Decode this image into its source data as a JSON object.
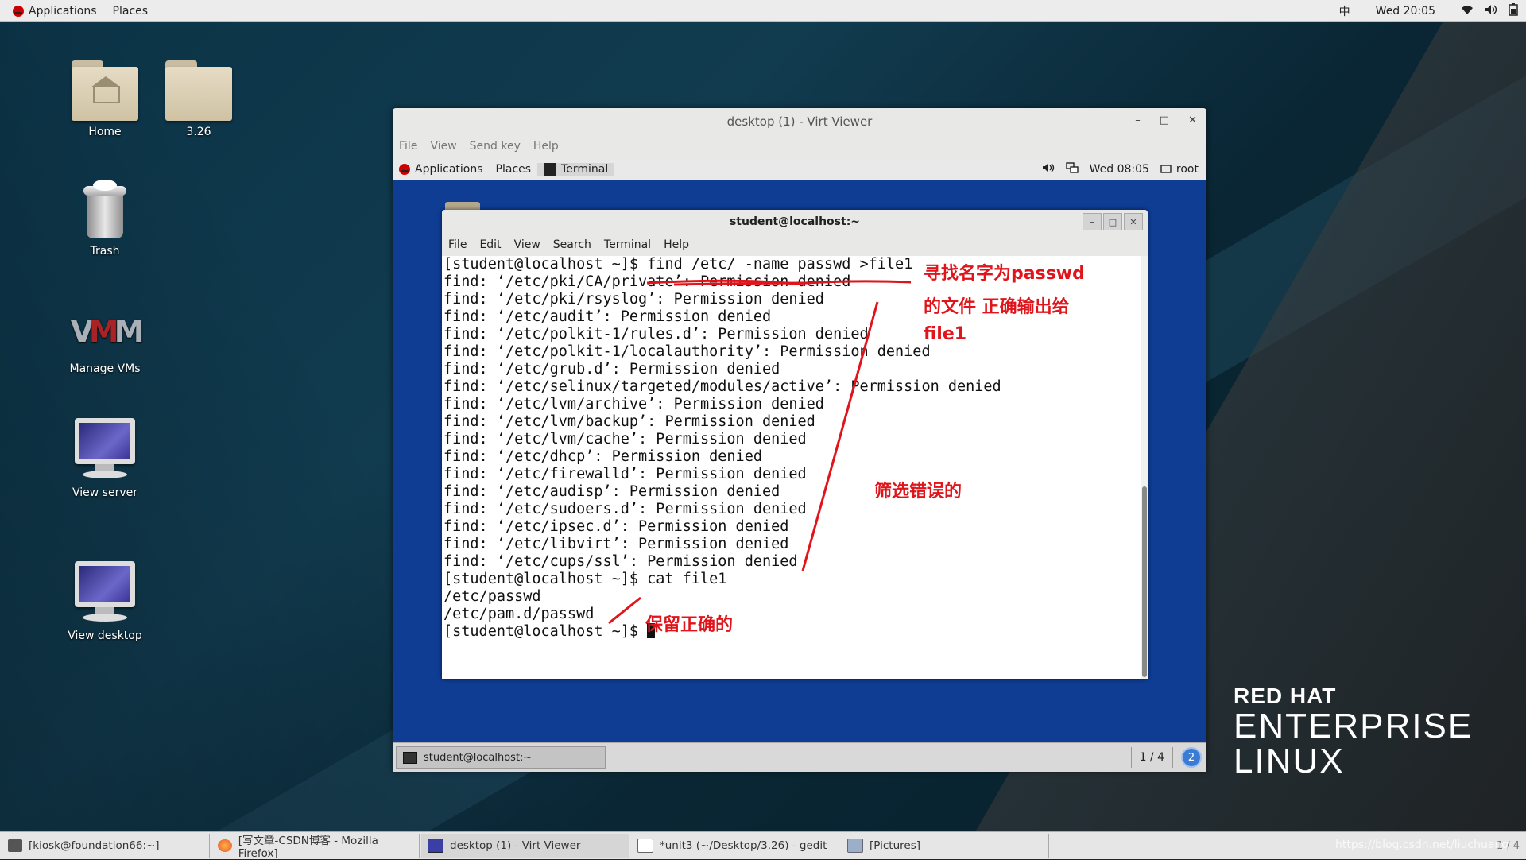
{
  "topbar": {
    "applications": "Applications",
    "places": "Places",
    "input_method": "中",
    "clock": "Wed 20:05"
  },
  "desktop": {
    "icons": [
      {
        "label": "Home"
      },
      {
        "label": "3.26"
      },
      {
        "label": "Trash"
      },
      {
        "label": "Manage VMs"
      },
      {
        "label": "View server"
      },
      {
        "label": "View desktop"
      }
    ],
    "logo": {
      "line1": "RED HAT",
      "line2": "ENTERPRISE",
      "line3": "LINUX"
    }
  },
  "virt_viewer": {
    "title": "desktop (1) - Virt Viewer",
    "menu": [
      "File",
      "View",
      "Send key",
      "Help"
    ],
    "guest_topbar": {
      "applications": "Applications",
      "places": "Places",
      "terminal": "Terminal",
      "clock": "Wed 08:05",
      "user": "root"
    },
    "guest_taskbar": {
      "task": "student@localhost:~",
      "pager": "1 / 4",
      "badge": "2"
    }
  },
  "terminal": {
    "title": "student@localhost:~",
    "menu": [
      "File",
      "Edit",
      "View",
      "Search",
      "Terminal",
      "Help"
    ],
    "lines": [
      "[student@localhost ~]$ find /etc/ -name passwd >file1",
      "find: ‘/etc/pki/CA/private’: Permission denied",
      "find: ‘/etc/pki/rsyslog’: Permission denied",
      "find: ‘/etc/audit’: Permission denied",
      "find: ‘/etc/polkit-1/rules.d’: Permission denied",
      "find: ‘/etc/polkit-1/localauthority’: Permission denied",
      "find: ‘/etc/grub.d’: Permission denied",
      "find: ‘/etc/selinux/targeted/modules/active’: Permission denied",
      "find: ‘/etc/lvm/archive’: Permission denied",
      "find: ‘/etc/lvm/backup’: Permission denied",
      "find: ‘/etc/lvm/cache’: Permission denied",
      "find: ‘/etc/dhcp’: Permission denied",
      "find: ‘/etc/firewalld’: Permission denied",
      "find: ‘/etc/audisp’: Permission denied",
      "find: ‘/etc/sudoers.d’: Permission denied",
      "find: ‘/etc/ipsec.d’: Permission denied",
      "find: ‘/etc/libvirt’: Permission denied",
      "find: ‘/etc/cups/ssl’: Permission denied",
      "[student@localhost ~]$ cat file1",
      "/etc/passwd",
      "/etc/pam.d/passwd"
    ],
    "prompt": "[student@localhost ~]$ "
  },
  "annotations": {
    "a1_line1": "寻找名字为passwd",
    "a1_line2": "的文件  正确输出给",
    "a1_line3": "file1",
    "a2": "筛选错误的",
    "a3": "保留正确的",
    "color": "#e0141a"
  },
  "taskbar": {
    "items": [
      "[kiosk@foundation66:~]",
      "[写文章-CSDN博客 - Mozilla Firefox]",
      "desktop (1) - Virt Viewer",
      "*unit3 (~/Desktop/3.26) - gedit",
      "[Pictures]"
    ],
    "pager": "1 / 4"
  },
  "watermark": "https://blog.csdn.net/liuchuang"
}
